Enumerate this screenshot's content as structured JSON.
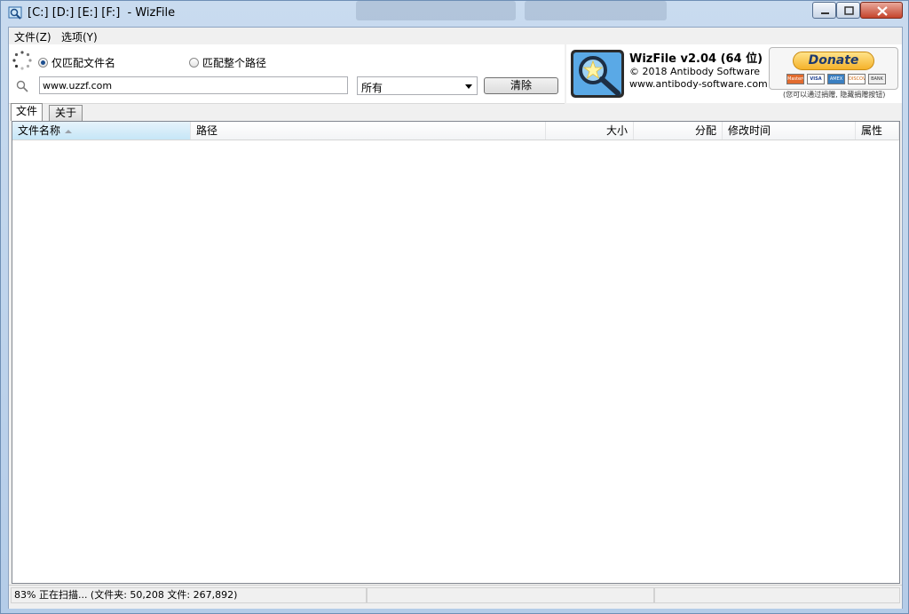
{
  "window": {
    "title": "[C:] [D:] [E:] [F:]  - WizFile"
  },
  "menu": {
    "file": "文件(Z)",
    "options": "选项(Y)"
  },
  "search": {
    "radio_filename_label": "仅匹配文件名",
    "radio_fullpath_label": "匹配整个路径",
    "selected_mode": "filename",
    "query_value": "www.uzzf.com",
    "filter_value": "所有",
    "clear_label": "清除"
  },
  "about": {
    "product_name": "WizFile v2.04 (64 位)",
    "copyright": "© 2018 Antibody Software",
    "website": "www.antibody-software.com",
    "donate_label": "Donate",
    "donate_note": "(您可以通过捐赠, 隐藏捐赠按钮)",
    "cards": [
      "MasterCard",
      "VISA",
      "AMEX",
      "DISCOVER",
      "BANK"
    ]
  },
  "tabs": [
    {
      "label": "文件",
      "active": true
    },
    {
      "label": "关于",
      "active": false
    }
  ],
  "columns": {
    "name": "文件名称",
    "path": "路径",
    "size": "大小",
    "alloc": "分配",
    "modified": "修改时间",
    "attributes": "属性"
  },
  "status": {
    "progress_text": "83% 正在扫描... (文件夹: 50,208  文件: 267,892)",
    "segment2": "",
    "segment3": ""
  },
  "colors": {
    "accent": "#1d4f8f",
    "donate": "#f5b22b",
    "sorted_column": "#c6e6f7"
  }
}
